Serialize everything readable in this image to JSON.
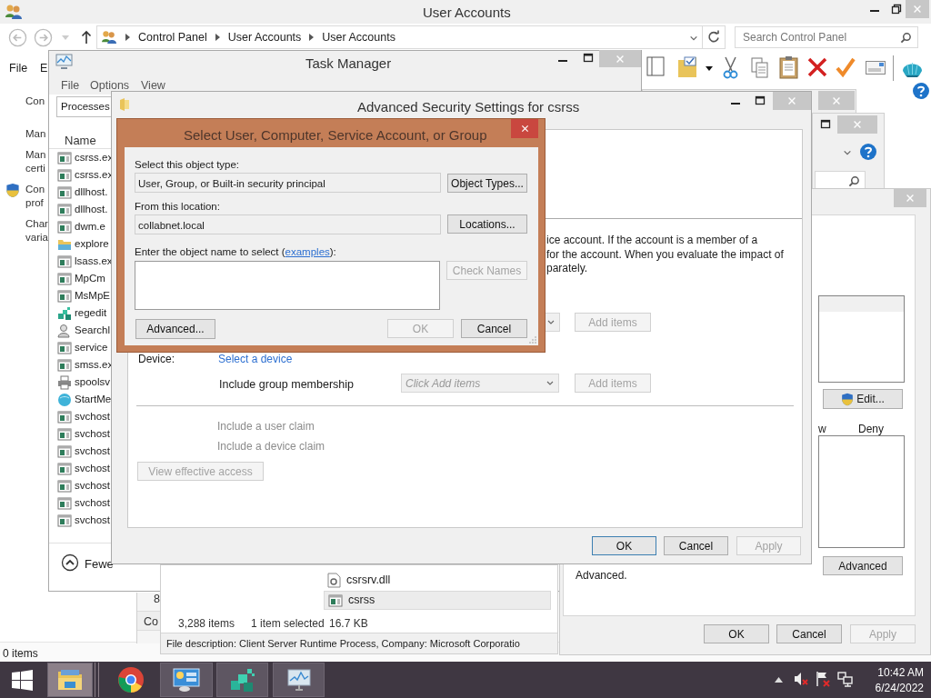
{
  "user_accounts_window": {
    "title": "User Accounts",
    "breadcrumb": [
      "Control Panel",
      "User Accounts",
      "User Accounts"
    ],
    "search": {
      "placeholder": "Search Control Panel"
    },
    "menu": [
      "File",
      "E"
    ],
    "side_links": [
      {
        "lines": [
          "Con"
        ],
        "kind": "link"
      },
      {
        "lines": [
          "Man"
        ],
        "kind": "link"
      },
      {
        "lines": [
          "Man",
          "certi"
        ],
        "kind": "link"
      },
      {
        "lines": [
          "Con",
          "prof"
        ],
        "kind": "admin-link"
      },
      {
        "lines": [
          "Char",
          "varia"
        ],
        "kind": "link"
      }
    ],
    "status": "0 items"
  },
  "back_window": {
    "column_1": "8",
    "column_2": "Co"
  },
  "explorer_window": {
    "files": [
      {
        "name": "csrsrv.dll",
        "kind": "dll",
        "selected": false
      },
      {
        "name": "csrss",
        "kind": "exe",
        "selected": true
      }
    ],
    "item_count": "3,288 items",
    "selection": "1 item selected",
    "size": "16.7 KB",
    "description": "File description: Client Server Runtime Process, Company: Microsoft Corporatio"
  },
  "properties_window": {
    "edit_button": "Edit...",
    "columns": [
      "w",
      "Deny"
    ],
    "advanced_button": "Advanced",
    "note": "Advanced.",
    "buttons": [
      {
        "label": "OK",
        "disabled": false,
        "default": false
      },
      {
        "label": "Cancel",
        "disabled": false,
        "default": false
      },
      {
        "label": "Apply",
        "disabled": true,
        "default": false
      }
    ]
  },
  "task_manager": {
    "title": "Task Manager",
    "menu": [
      "File",
      "Options",
      "View"
    ],
    "tabs": [
      {
        "label": "Processes",
        "selected": true
      }
    ],
    "column": "Name",
    "processes": [
      {
        "name": "csrss.ex",
        "kind": "window"
      },
      {
        "name": "csrss.ex",
        "kind": "window"
      },
      {
        "name": "dllhost.",
        "kind": "window"
      },
      {
        "name": "dllhost.",
        "kind": "window"
      },
      {
        "name": "dwm.e",
        "kind": "window"
      },
      {
        "name": "explore",
        "kind": "folder"
      },
      {
        "name": "lsass.ex",
        "kind": "window"
      },
      {
        "name": "MpCm",
        "kind": "window"
      },
      {
        "name": "MsMpE",
        "kind": "window"
      },
      {
        "name": "regedit",
        "kind": "registry"
      },
      {
        "name": "Searchl",
        "kind": "search"
      },
      {
        "name": "service",
        "kind": "window"
      },
      {
        "name": "smss.ex",
        "kind": "window"
      },
      {
        "name": "spoolsv",
        "kind": "printer"
      },
      {
        "name": "StartMe",
        "kind": "globe"
      },
      {
        "name": "svchost",
        "kind": "window"
      },
      {
        "name": "svchost",
        "kind": "window"
      },
      {
        "name": "svchost",
        "kind": "window"
      },
      {
        "name": "svchost",
        "kind": "window"
      },
      {
        "name": "svchost",
        "kind": "window"
      },
      {
        "name": "svchost",
        "kind": "window"
      },
      {
        "name": "svchost",
        "kind": "window"
      }
    ],
    "fewer": "Fewe"
  },
  "security_window": {
    "title": "Advanced Security Settings for csrss",
    "description": [
      "ice account. If the account is a member of a",
      "for the account. When you evaluate the impact of",
      "parately."
    ],
    "principal_add": {
      "label": "Add items",
      "disabled": true
    },
    "device_label": "Device:",
    "device_link": "Select a device",
    "group_label": "Include group membership",
    "group_dropdown": "Click Add items",
    "group_add": {
      "label": "Add items",
      "disabled": true
    },
    "claims": [
      "Include a user claim",
      "Include a device claim"
    ],
    "effective_access": {
      "label": "View effective access",
      "disabled": true
    },
    "buttons": [
      {
        "label": "OK",
        "disabled": false,
        "default": true
      },
      {
        "label": "Cancel",
        "disabled": false,
        "default": false
      },
      {
        "label": "Apply",
        "disabled": true,
        "default": false
      }
    ]
  },
  "select_dialog": {
    "title": "Select User, Computer, Service Account, or Group",
    "type_label": "Select this object type:",
    "type_value": "User, Group, or Built-in security principal",
    "type_button": "Object Types...",
    "location_label": "From this location:",
    "location_value": "collabnet.local",
    "location_button": "Locations...",
    "name_label": "Enter the object name to select (",
    "name_link": "examples",
    "name_label_end": "):",
    "check_button": {
      "label": "Check Names",
      "disabled": true
    },
    "advanced_button": "Advanced...",
    "ok_button": {
      "label": "OK",
      "disabled": true
    },
    "cancel_button": {
      "label": "Cancel",
      "disabled": false
    }
  },
  "taskbar": {
    "apps": [
      {
        "kind": "explorer",
        "open": true,
        "selected": true
      },
      {
        "kind": "chrome",
        "open": false,
        "selected": false
      },
      {
        "kind": "control-panel",
        "open": true,
        "selected": false
      },
      {
        "kind": "registry",
        "open": true,
        "selected": false
      },
      {
        "kind": "monitor",
        "open": true,
        "selected": false
      }
    ],
    "clock": {
      "time": "10:42 AM",
      "date": "6/24/2022"
    }
  }
}
